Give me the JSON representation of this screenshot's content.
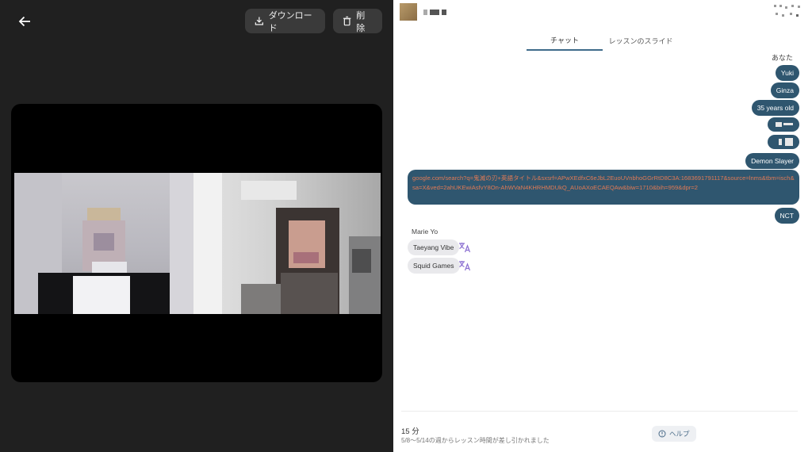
{
  "toolbar": {
    "download_label": "ダウンロード",
    "delete_label": "削除"
  },
  "chat": {
    "tabs": [
      {
        "label": "チャット",
        "active": true
      },
      {
        "label": "レッスンのスライド",
        "active": false
      }
    ],
    "me_label": "あなた",
    "my_messages": [
      "Yuki",
      "Ginza",
      "35 years old",
      "Demon Slayer",
      "google.com/search?q=鬼滅の刃+英語タイトル&sxsrf=APwXEdfxC6eJbL2EuoUVnbhoGGrRtD8C3A:1683691791117&source=lnms&tbm=isch&sa=X&ved=2ahUKEwiAsfvY8On-AhWVaN4KHRHMDUkQ_AUoAXoECAEQAw&biw=1710&bih=959&dpr=2",
      "NCT"
    ],
    "other_name": "Marie Yo",
    "other_messages": [
      "Taeyang Vibe",
      "Squid Games"
    ]
  },
  "footer": {
    "duration": "15 分",
    "notice": "5/8〜5/14の週からレッスン時間が差し引かれました",
    "help_label": "ヘルプ"
  },
  "colors": {
    "my_bubble": "#2f566f",
    "link_text": "#e07a55",
    "active_tab_underline": "#3f6b8a",
    "translate_icon": "#8b6fd1"
  }
}
